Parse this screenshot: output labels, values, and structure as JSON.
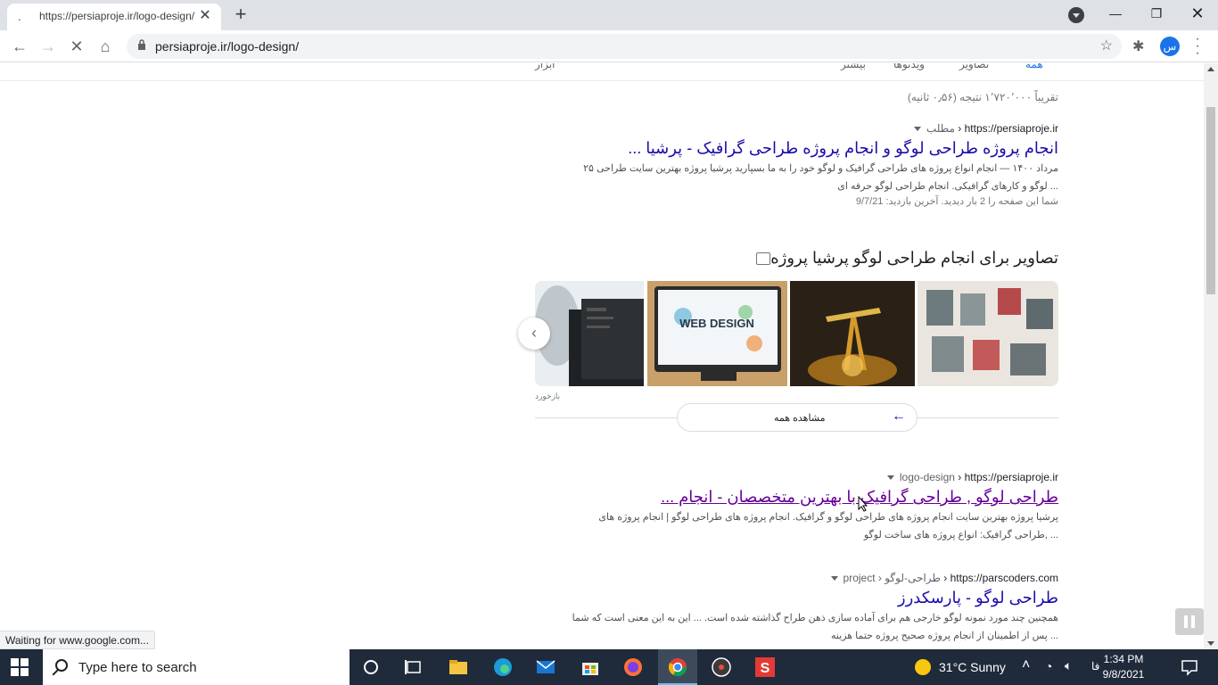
{
  "browser": {
    "tab_title": "https://persiaproje.ir/logo-design/",
    "tab_favicon": ".",
    "url": "persiaproje.ir/logo-design/",
    "profile_initial": "س",
    "status_text": "Waiting for www.google.com..."
  },
  "serp": {
    "tabs": [
      "همه",
      "تصاویر",
      "ویدئوها",
      "بیشتر",
      "ابزار"
    ],
    "result_count": "تقریباً ۱٬۷۲۰٬۰۰۰ نتیجه (۰٫۵۶ ثانیه)",
    "result1": {
      "domain": "https://persiaproje.ir",
      "crumb": "مطلب",
      "title": "انجام پروژه طراحی لوگو و انجام پروژه طراحی گرافیک - پرشیا ...",
      "snippet_line1": "۲۵ مرداد ۱۴۰۰ — انجام انواع پروژه های طراحی گرافیک و لوگو خود را به ما بسپارید پرشیا پروژه بهترین سایت طراحی",
      "snippet_line2": "لوگو و کارهای گرافیکی. انجام طراحی لوگو حرفه ای ...",
      "visit_note": "شما این صفحه را 2 بار دیدید. آخرین بازدید: 9/7/21"
    },
    "images": {
      "heading": "تصاویر برای انجام طراحی لوگو پرشیا پروژه",
      "source": "بازخورد",
      "see_all": "مشاهده همه",
      "thumb_labels": [
        "",
        "WEB DESIGN",
        "",
        ""
      ]
    },
    "result2": {
      "domain": "https://persiaproje.ir",
      "crumb": "logo-design",
      "title": "طراحی لوگو , طراحی گرافیک با بهترین متخصصان - انجام ...",
      "snippet_line1": "پرشیا پروژه بهترین سایت انجام پروژه های طراحی لوگو و گرافیک. انجام پروژه های طراحی لوگو | انجام پروژه های",
      "snippet_line2": "طراحی گرافیک: انواع پروژه های ساخت لوگو, ..."
    },
    "result3": {
      "domain": "https://parscoders.com",
      "crumb": "project › طراحی-لوگو",
      "title": "طراحی لوگو - پارسکدرز",
      "snippet_line1": "همچنین چند مورد نمونه لوگو خارجی هم برای آماده سازی ذهن طراح گذاشته شده است. ... این به این معنی است که شما",
      "snippet_line2": "پس از اطمینان از انجام پروژه صحیح پروژه حتما هزینه ..."
    }
  },
  "taskbar": {
    "search_placeholder": "Type here to search",
    "weather": "31°C  Sunny",
    "lang": "فا",
    "time": "1:34 PM",
    "date": "9/8/2021"
  },
  "colors": {
    "link": "#1a0dab",
    "visited": "#660099",
    "taskbar": "#1f2a3a"
  }
}
